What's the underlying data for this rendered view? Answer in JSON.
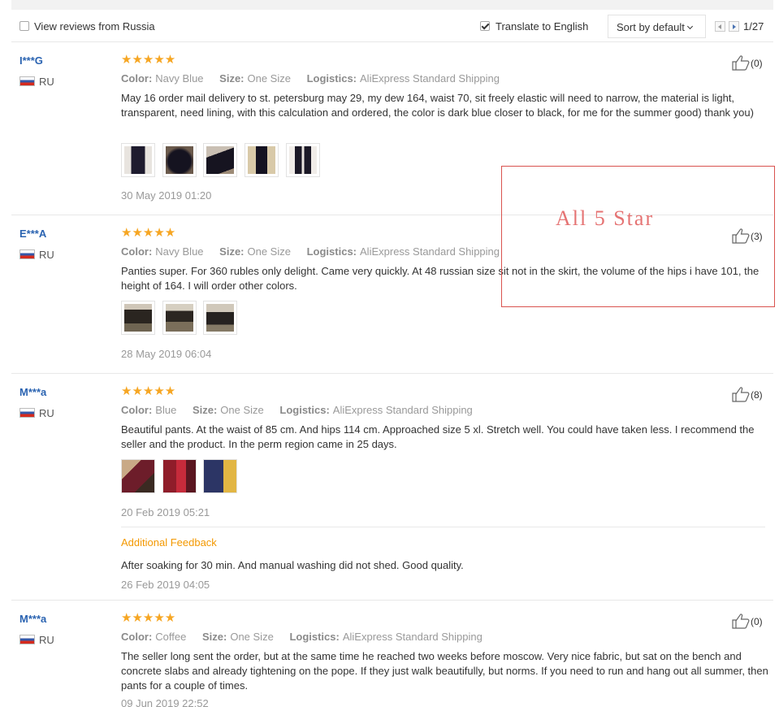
{
  "toolbar": {
    "view_russia_label": "View reviews from Russia",
    "view_russia_checked": false,
    "translate_label": "Translate to English",
    "translate_checked": true,
    "sort_label": "Sort by default",
    "page_indicator": "1/27"
  },
  "labels": {
    "color": "Color:",
    "size": "Size:",
    "logistics": "Logistics:",
    "additional_feedback": "Additional Feedback"
  },
  "reviews": [
    {
      "user": "I***G",
      "country": "RU",
      "stars": "★★★★★",
      "color": "Navy Blue",
      "size": "One Size",
      "logistics": "AliExpress Standard Shipping",
      "text": "May 16 order mail delivery to st. petersburg may 29, my dew 164, waist 70, sit freely elastic will need to narrow, the material is light, transparent, need lining, with this calculation and ordered, the color is dark blue closer to black, for me for the summer good) thank you)",
      "date": "30 May 2019 01:20",
      "likes": "(0)"
    },
    {
      "user": "E***A",
      "country": "RU",
      "stars": "★★★★★",
      "color": "Navy Blue",
      "size": "One Size",
      "logistics": "AliExpress Standard Shipping",
      "text": "Panties super. For 360 rubles only delight. Came very quickly. At 48 russian size sit not in the skirt, the volume of the hips i have 101, the height of 164. I will order other colors.",
      "date": "28 May 2019 06:04",
      "likes": "(3)"
    },
    {
      "user": "M***a",
      "country": "RU",
      "stars": "★★★★★",
      "color": "Blue",
      "size": "One Size",
      "logistics": "AliExpress Standard Shipping",
      "text": "Beautiful pants. At the waist of 85 cm. And hips 114 cm. Approached size 5 xl. Stretch well. You could have taken less. I recommend the seller and the product. In the perm region came in 25 days.",
      "date": "20 Feb 2019 05:21",
      "likes": "(8)",
      "additional_text": "After soaking for 30 min. And manual washing did not shed. Good quality.",
      "additional_date": "26 Feb 2019 04:05"
    },
    {
      "user": "M***a",
      "country": "RU",
      "stars": "★★★★★",
      "color": "Coffee",
      "size": "One Size",
      "logistics": "AliExpress Standard Shipping",
      "text": "The seller long sent the order, but at the same time he reached two weeks before moscow. Very nice fabric, but sat on the bench and concrete slabs and already tightening on the pope. If they just walk beautifully, but norms. If you need to run and hang out all summer, then pants for a couple of times.",
      "date": "09 Jun 2019 22:52",
      "likes": "(0)"
    }
  ],
  "annotation": {
    "text": "All 5 Star",
    "color": "#e57373"
  },
  "colors": {
    "username": "#2a63b1",
    "stars": "#f6a623",
    "additional_feedback": "#f39800"
  }
}
